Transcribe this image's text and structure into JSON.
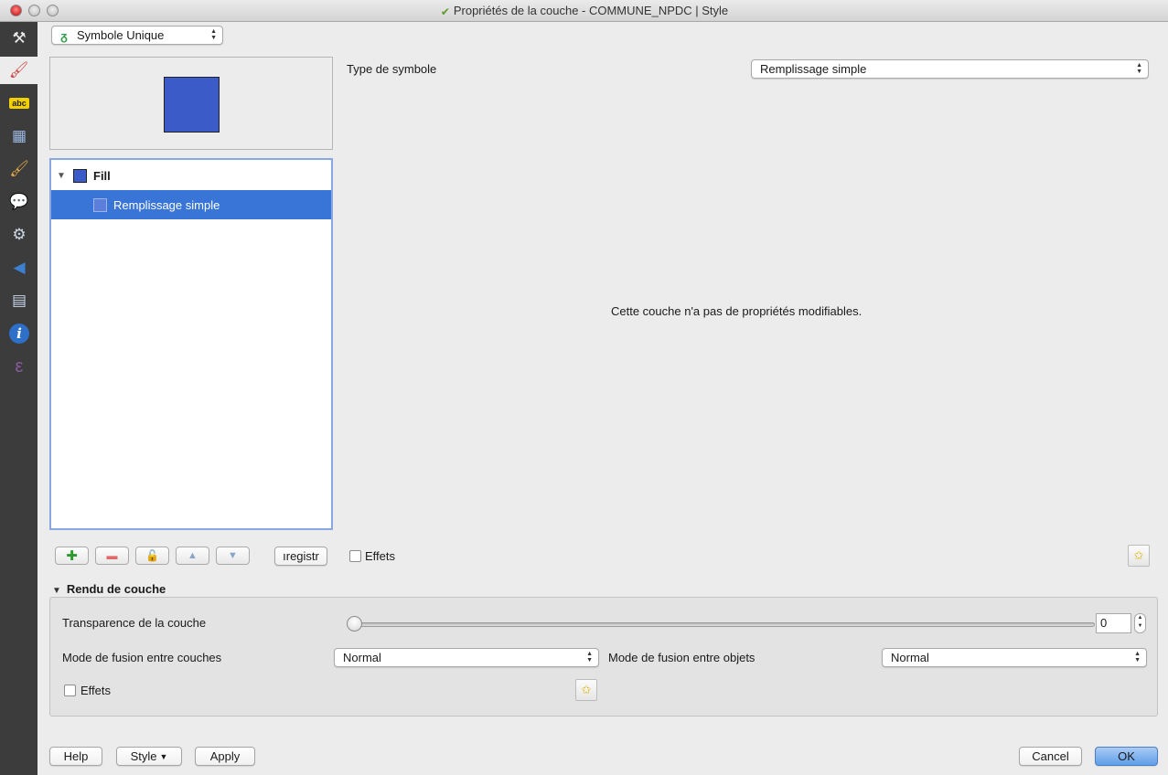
{
  "window": {
    "title": "Propriétés de la couche - COMMUNE_NPDC | Style"
  },
  "sidebar": {
    "items": [
      {
        "name": "general-icon",
        "glyph": "⚒"
      },
      {
        "name": "style-icon",
        "glyph": "🖌"
      },
      {
        "name": "labels-icon",
        "glyph": "abc"
      },
      {
        "name": "fields-icon",
        "glyph": "▦"
      },
      {
        "name": "rendering-icon",
        "glyph": "🖌"
      },
      {
        "name": "display-icon",
        "glyph": "💬"
      },
      {
        "name": "actions-icon",
        "glyph": "⚙"
      },
      {
        "name": "joins-icon",
        "glyph": "◀"
      },
      {
        "name": "diagrams-icon",
        "glyph": "▤"
      },
      {
        "name": "metadata-icon",
        "glyph": "i"
      },
      {
        "name": "variables-icon",
        "glyph": "ε"
      }
    ]
  },
  "renderer": {
    "selected": "Symbole Unique"
  },
  "symbol_tree": {
    "root": "Fill",
    "child": "Remplissage simple"
  },
  "symbol_type": {
    "label": "Type de symbole",
    "selected": "Remplissage simple"
  },
  "message": "Cette couche n'a pas de propriétés modifiables.",
  "toolbar": {
    "save_label": "ıregistr",
    "effects_label": "Effets"
  },
  "layer_rendering": {
    "header": "Rendu de couche",
    "transparency_label": "Transparence de la couche",
    "transparency_value": "0",
    "transparency_fraction": 0,
    "layer_blend_label": "Mode de fusion entre couches",
    "layer_blend_value": "Normal",
    "feature_blend_label": "Mode de fusion entre objets",
    "feature_blend_value": "Normal",
    "effects_label": "Effets"
  },
  "footer": {
    "help": "Help",
    "style": "Style",
    "apply": "Apply",
    "cancel": "Cancel",
    "ok": "OK"
  },
  "colors": {
    "symbol_fill": "#3a5bc8",
    "selection": "#3875d7",
    "sidebar_bg": "#3c3c3c"
  }
}
